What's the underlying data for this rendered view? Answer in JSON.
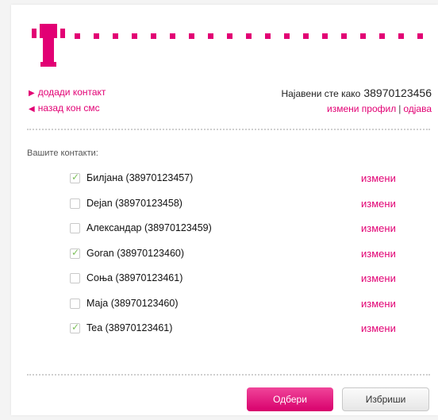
{
  "brand": {
    "logo_name": "telekom-t-logo",
    "color": "#e20074"
  },
  "nav": {
    "add_contact": "додади контакт",
    "back_to_sms": "назад кон смс",
    "add_icon": "triangle-right-icon",
    "back_icon": "triangle-left-icon"
  },
  "account": {
    "logged_in_label": "Најавени сте како",
    "phone": "38970123456",
    "edit_profile": "измени профил",
    "separator": "|",
    "logout": "одјава"
  },
  "contacts": {
    "heading": "Вашите контакти:",
    "items": [
      {
        "name": "Билјана (38970123457)",
        "checked": true,
        "edit": "измени"
      },
      {
        "name": "Dejan (38970123458)",
        "checked": false,
        "edit": "измени"
      },
      {
        "name": "Александар (38970123459)",
        "checked": false,
        "edit": "измени"
      },
      {
        "name": "Goran (38970123460)",
        "checked": true,
        "edit": "измени"
      },
      {
        "name": "Соња (38970123461)",
        "checked": false,
        "edit": "измени"
      },
      {
        "name": "Маја (38970123460)",
        "checked": false,
        "edit": "измени"
      },
      {
        "name": "Tea (38970123461)",
        "checked": true,
        "edit": "измени"
      }
    ]
  },
  "buttons": {
    "select": "Одбери",
    "delete": "Избриши"
  }
}
